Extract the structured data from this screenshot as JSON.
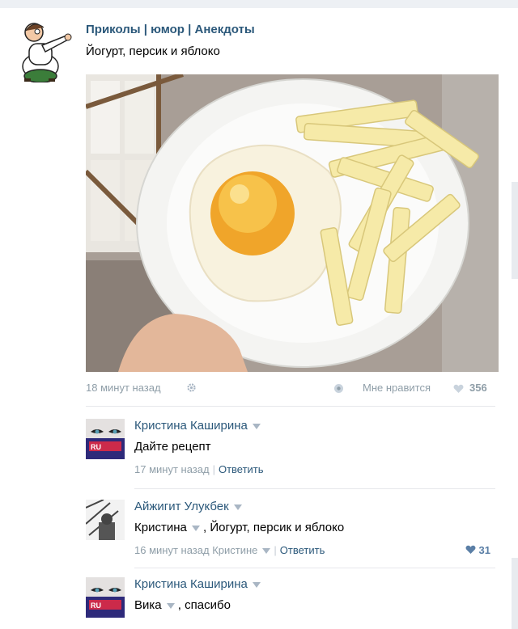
{
  "post": {
    "group_name": "Приколы | юмор | Анекдоты",
    "text": "Йогурт, персик и яблоко",
    "avatar_icon": "cartoon-character-avatar",
    "photo_icon": "plate-yogurt-peach-apple-photo",
    "time": "18 минут назад",
    "like_label": "Мне нравится",
    "like_count": "356"
  },
  "comments": [
    {
      "author": "Кристина Каширина",
      "text": "Дайте рецепт",
      "time": "17 минут назад",
      "reply_label": "Ответить"
    },
    {
      "author": "Айжигит Улукбек",
      "mention": "Кристина",
      "text": ", Йогурт, персик и яблоко",
      "time": "16 минут назад",
      "reply_to": "Кристине",
      "reply_label": "Ответить",
      "likes": "31"
    },
    {
      "author": "Кристина Каширина",
      "mention": "Вика",
      "text": ", спасибо"
    }
  ],
  "colors": {
    "link": "#2b587a",
    "meta": "#8f9ea8",
    "like_heart": "#5b7fa6"
  }
}
